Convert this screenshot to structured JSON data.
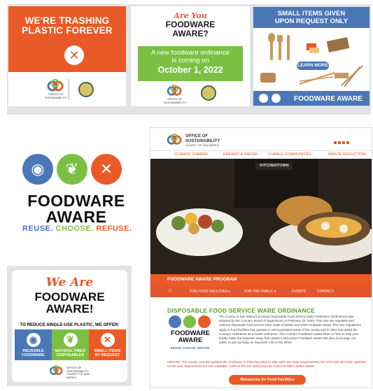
{
  "card1": {
    "title_line1": "WE'RE TRASHING",
    "title_line2": "PLASTIC FOREVER"
  },
  "card2": {
    "are_you": "Are You",
    "foodware": "FOODWARE",
    "aware": "AWARE?",
    "line1": "A new foodware ordinance",
    "line2": "is coming on",
    "date": "October 1, 2022"
  },
  "card3": {
    "line1": "SMALL ITEMS GIVEN",
    "line2": "UPON REQUEST ONLY",
    "learn_more": "LEARN MORE",
    "footer": "FOODWARE AWARE"
  },
  "office": {
    "line1": "OFFICE OF",
    "line2": "SUSTAINABILITY",
    "line3": "COUNTY OF SAN MATEO"
  },
  "logo": {
    "line1": "FOODWARE",
    "line2": "AWARE",
    "reuse": "REUSE.",
    "choose": "CHOOSE.",
    "refuse": "REFUSE."
  },
  "flyer": {
    "we_are": "We Are",
    "foodware": "FOODWARE",
    "aware": "AWARE!",
    "reduce": "TO REDUCE SINGLE-USE PLASTIC, WE OFFER:",
    "tiles": [
      {
        "l1": "REUSABLE",
        "l2": "FOODWARE",
        "color": "#4a77b6"
      },
      {
        "l1": "NATURAL FIBER",
        "l2": "DISPOSABLES",
        "color": "#7bc043"
      },
      {
        "l1": "SMALL ITEMS",
        "l2": "BY REQUEST",
        "color": "#ea5a26"
      }
    ]
  },
  "website": {
    "office_l1": "OFFICE OF",
    "office_l2": "SUSTAINABILITY",
    "office_l3": "COUNTY OF SAN MATEO",
    "nav": [
      "CLIMATE CHANGE",
      "ENERGY & WATER",
      "LIVABLE COMMUNITIES",
      "WASTE REDUCTION"
    ],
    "hero_sign": "KITCHENTOWN",
    "program": "FOODWARE AWARE PROGRAM",
    "subnav": [
      "FOR FOOD FACILITIES ▾",
      "FOR THE PUBLIC ▾",
      "EVENTS",
      "CONTACT"
    ],
    "ord_title": "DISPOSABLE FOOD SERVICE WARE ORDINANCE",
    "ord_body": "The County of San Mateo's (County) Disposable Food Service Ware Ordinance (Ordinance) was adopted by the County's Board of Supervisors on February 25, 2020. This new law regulates and reduces disposable food service ware made of plastic and other foodware waste. The new regulations apply to food facilities that operate in unincorporated areas of the county and in cities that adopt the County's Ordinance as a model ordinance. The County's Foodware Aware Team is here to help your facility make the transition away from plastics and reduce foodware waste! We also encourage our public to join and play an important role in this effort!",
    "update": "UPDATE: The County recently updated the Ordinance in February 2022 to align with new state requirements (AB 1276 and AB 1200). Updates on the new requirements are now available. Click on the red \"Resources for Food Facilities\" button below!",
    "resources_btn": "Resources for Food Facilities",
    "logo_l1": "FOODWARE",
    "logo_l2": "AWARE",
    "logo_tag": "REUSE. CHOOSE. REFUSE."
  },
  "colors": {
    "orange": "#ea5a26",
    "green": "#7bc043",
    "blue": "#4a77b6"
  }
}
